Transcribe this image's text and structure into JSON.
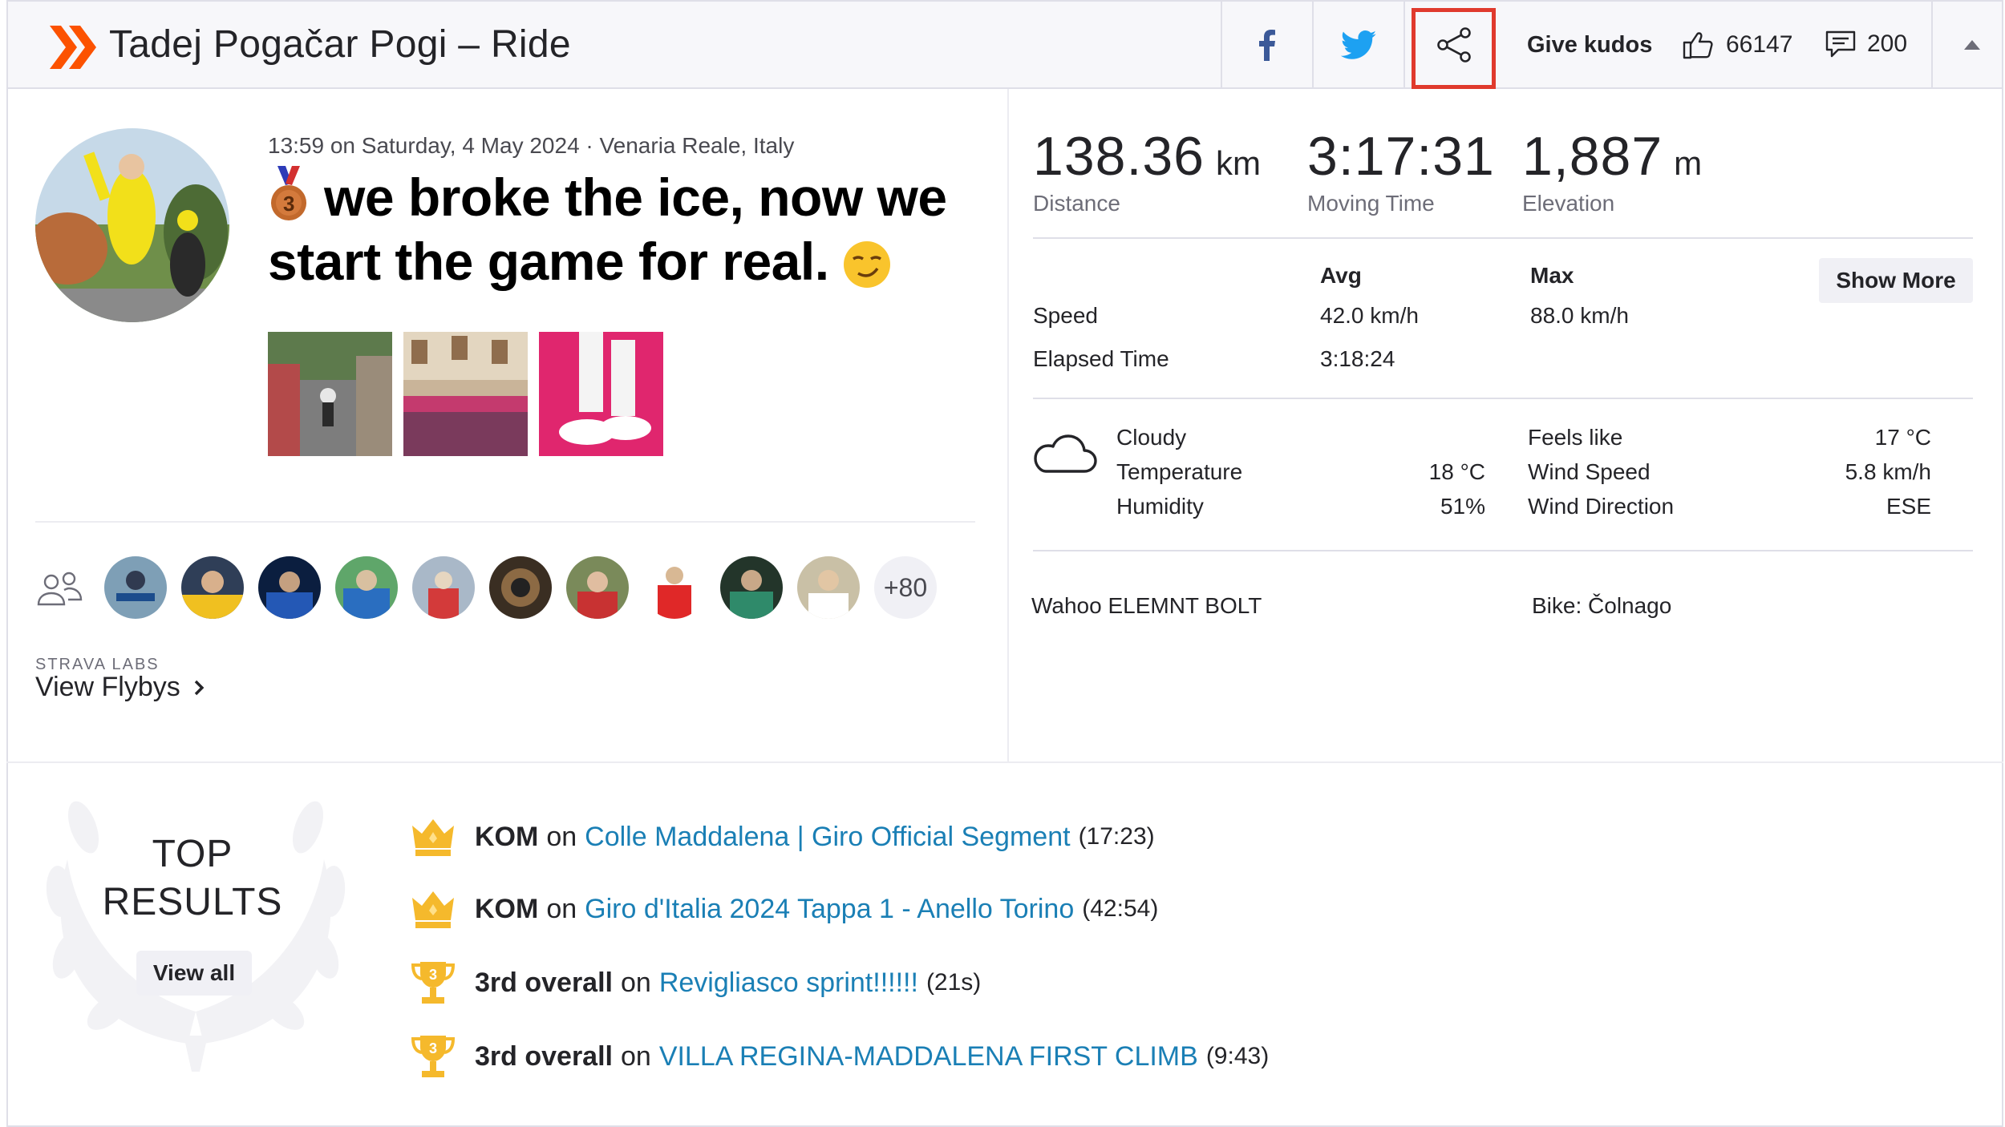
{
  "header": {
    "title": "Tadej Pogačar Pogi – Ride",
    "give_kudos": "Give kudos",
    "kudos_count": "66147",
    "comments_count": "200",
    "icons": [
      "facebook-icon",
      "twitter-icon",
      "share-icon",
      "thumbs-up-icon",
      "comment-icon",
      "caret-up-icon"
    ]
  },
  "activity": {
    "meta": "13:59 on Saturday, 4 May 2024 · Venaria Reale, Italy",
    "headline": "we broke the ice, now we start the game for real.",
    "photos_count": 3
  },
  "athletes": {
    "more": "+80"
  },
  "flyby": {
    "labs_label": "STRAVA LABS",
    "link": "View Flybys"
  },
  "stats": {
    "distance": {
      "value": "138.36",
      "unit": "km",
      "label": "Distance"
    },
    "moving_time": {
      "value": "3:17:31",
      "label": "Moving Time"
    },
    "elevation": {
      "value": "1,887",
      "unit": "m",
      "label": "Elevation"
    },
    "table": {
      "avg_header": "Avg",
      "max_header": "Max",
      "show_more": "Show More",
      "rows": [
        {
          "label": "Speed",
          "avg": "42.0 km/h",
          "max": "88.0 km/h"
        },
        {
          "label": "Elapsed Time",
          "avg": "3:18:24",
          "max": ""
        }
      ]
    }
  },
  "weather": {
    "condition": "Cloudy",
    "temperature_label": "Temperature",
    "temperature": "18 °C",
    "humidity_label": "Humidity",
    "humidity": "51%",
    "feels_like_label": "Feels like",
    "feels_like": "17 °C",
    "wind_speed_label": "Wind Speed",
    "wind_speed": "5.8 km/h",
    "wind_direction_label": "Wind Direction",
    "wind_direction": "ESE"
  },
  "gear": {
    "device": "Wahoo ELEMNT BOLT",
    "bike": "Bike: Čolnago"
  },
  "top_results": {
    "title_line1": "TOP",
    "title_line2": "RESULTS",
    "view_all": "View all",
    "on": "on",
    "items": [
      {
        "type": "crown",
        "rank": "KOM",
        "segment": "Colle Maddalena | Giro Official Segment",
        "time": "(17:23)"
      },
      {
        "type": "crown",
        "rank": "KOM",
        "segment": "Giro d'Italia 2024 Tappa 1 - Anello Torino",
        "time": "(42:54)"
      },
      {
        "type": "trophy",
        "rank": "3rd overall",
        "segment": "Revigliasco sprint!!!!!!",
        "time": "(21s)"
      },
      {
        "type": "trophy",
        "rank": "3rd overall",
        "segment": "VILLA REGINA-MADDALENA FIRST CLIMB",
        "time": "(9:43)"
      }
    ]
  },
  "colors": {
    "brand": "#fc5200",
    "link": "#1a7fb5",
    "gold": "#f5b92c",
    "facebook": "#3b5998",
    "twitter": "#1da1f2",
    "highlight": "#e03a2d"
  }
}
